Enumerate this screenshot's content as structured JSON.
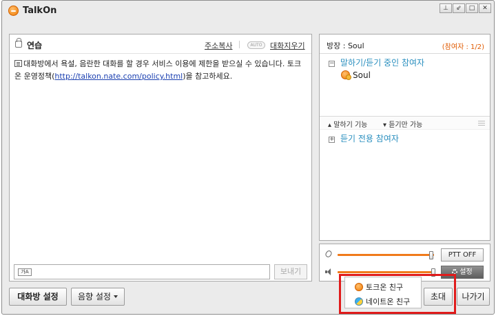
{
  "app": {
    "title": "TalkOn"
  },
  "window_controls": {
    "collapse": "⊥",
    "restore": "⇙",
    "maximize": "□",
    "close": "✕"
  },
  "chat": {
    "room_name": "연습",
    "copy_address": "주소복사",
    "auto_badge": "AUTO",
    "clear_chat": "대화지우기",
    "notice_part1": "대화방에서 욕설, 음란한 대화를 할 경우 서비스 이용에 제한을 받으실 수 있습니다.  토크온 운영정책(",
    "notice_link": "http://talkon.nate.com/policy.html",
    "notice_part2": ")을 참고하세요.",
    "input_value": "",
    "ime_indicator": "가A",
    "send_label": "보내기"
  },
  "participants": {
    "host_label": "방장 : Soul",
    "count_label": "(참여자 : 1/2)",
    "speaking_group": "말하기/듣기 중인 참여자",
    "speaking_group_toggle": "−",
    "users": [
      "Soul"
    ],
    "speak_enable": "말하기 기능",
    "listen_only": "듣기만 가능",
    "listen_group": "듣기 전용 참여자",
    "listen_group_toggle": "+"
  },
  "audio": {
    "mic_level": 0.97,
    "speaker_level": 0.99,
    "ptt_label": "PTT OFF",
    "settings_label": "설정"
  },
  "bottom": {
    "room_settings": "대화방 설정",
    "sound_settings": "음향 설정",
    "invite": "초대",
    "exit": "나가기"
  },
  "invite_menu": {
    "items": [
      "토크온 친구",
      "네이트온 친구"
    ]
  },
  "colors": {
    "accent": "#f07a1a",
    "group_blue": "#2a8fbf",
    "highlight_red": "#e01b1b"
  }
}
